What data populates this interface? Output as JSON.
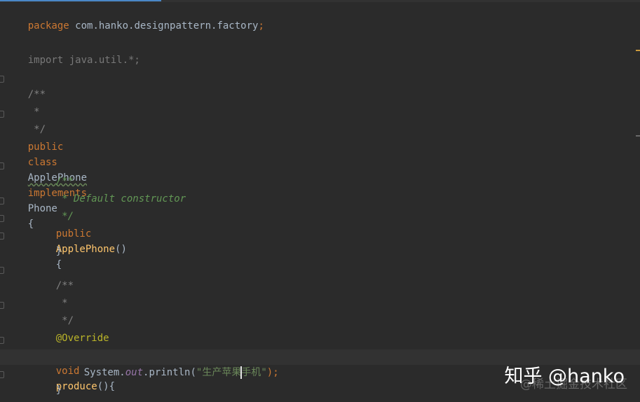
{
  "code": {
    "package_kw": "package",
    "package_name": " com.hanko.designpattern.factory",
    "semi": ";",
    "import_line": "import java.util.*;",
    "doc_open": "/**",
    "doc_star": " *",
    "doc_close": " */",
    "public_kw": "public",
    "class_kw": "class",
    "class_name": "ApplePhone",
    "implements_kw": "implements",
    "interface_name": "Phone",
    "open_brace": "{",
    "close_brace": "}",
    "ctor_doc_open": "/**",
    "ctor_doc_text": " * Default constructor",
    "ctor_doc_close": " */",
    "ctor_name": "ApplePhone",
    "ctor_parens": "()",
    "method_doc_open": "/**",
    "method_doc_star": " *",
    "method_doc_close": " */",
    "annotation": "@Override",
    "void_kw": "void",
    "method_name": "produce",
    "method_parens": "(){",
    "system": "System.",
    "out": "out",
    "println": ".println(",
    "string_part1": "\"生产苹果",
    "string_part2": "手机\"",
    "call_end": ");"
  },
  "watermark": {
    "main": "知乎 @hanko",
    "sub": "@稀土掘金技术社区"
  },
  "colors": {
    "background": "#2b2b2b",
    "keyword": "#cc7832",
    "comment": "#808080",
    "doc_comment": "#629755",
    "annotation": "#bbb529",
    "string": "#6a8759",
    "method": "#ffc66d",
    "field": "#9876aa",
    "text": "#a9b7c6"
  }
}
